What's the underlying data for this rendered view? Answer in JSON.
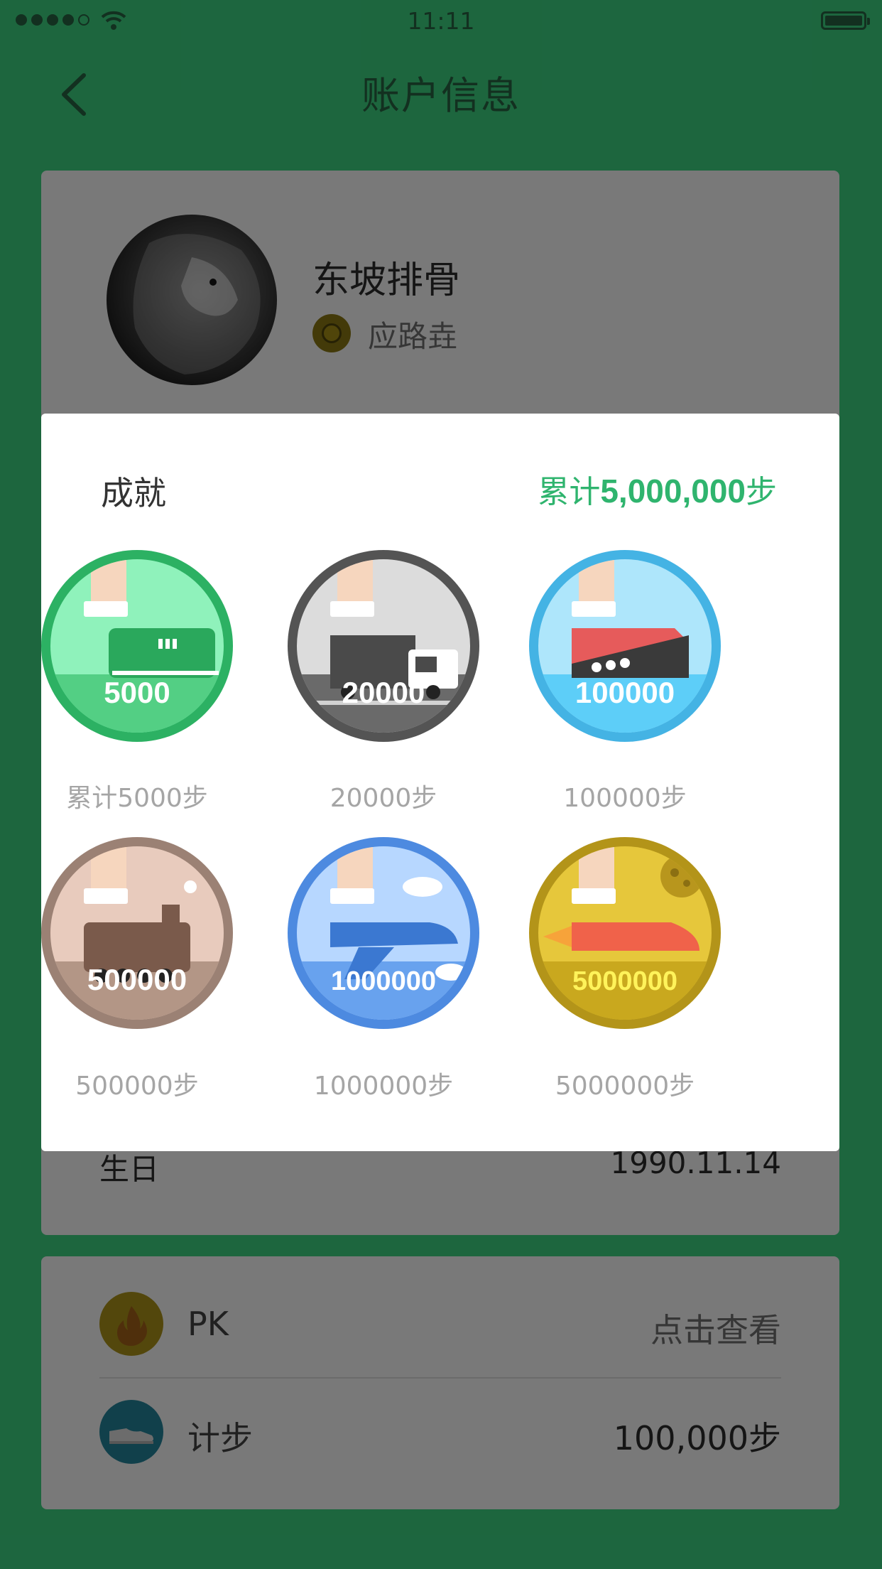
{
  "status_bar": {
    "time": "11:11"
  },
  "nav": {
    "title": "账户信息"
  },
  "profile": {
    "name": "东坡排骨",
    "level": "应路垚"
  },
  "birthday": {
    "label": "生日",
    "value": "1990.11.14"
  },
  "stats": [
    {
      "label": "PK",
      "value": "点击查看"
    },
    {
      "label": "计步",
      "value": "100,000步"
    }
  ],
  "achievements": {
    "title": "成就",
    "total_prefix": "累计",
    "total_value": "5,000,000",
    "total_suffix": "步",
    "badges": [
      {
        "number": "5000",
        "caption": "累计5000步",
        "icon": "car-icon",
        "ring": "#2cb163",
        "bg": "#8ff2bb",
        "band": "#53cf84"
      },
      {
        "number": "20000",
        "caption": "20000步",
        "icon": "truck-icon",
        "ring": "#545454",
        "bg": "#dcdcdc",
        "band": "#6a6a6a"
      },
      {
        "number": "100000",
        "caption": "100000步",
        "icon": "ship-icon",
        "ring": "#44b3e4",
        "bg": "#aee6fb",
        "band": "#5dcef8"
      },
      {
        "number": "500000",
        "caption": "500000步",
        "icon": "train-icon",
        "ring": "#9b8174",
        "bg": "#e8cbbd",
        "band": "#b39686"
      },
      {
        "number": "1000000",
        "caption": "1000000步",
        "icon": "plane-icon",
        "ring": "#4d8ae0",
        "bg": "#b7d7ff",
        "band": "#68a2ee"
      },
      {
        "number": "5000000",
        "caption": "5000000步",
        "icon": "rocket-icon",
        "ring": "#b39419",
        "bg": "#e6c73b",
        "band": "#c9a81e"
      }
    ]
  }
}
